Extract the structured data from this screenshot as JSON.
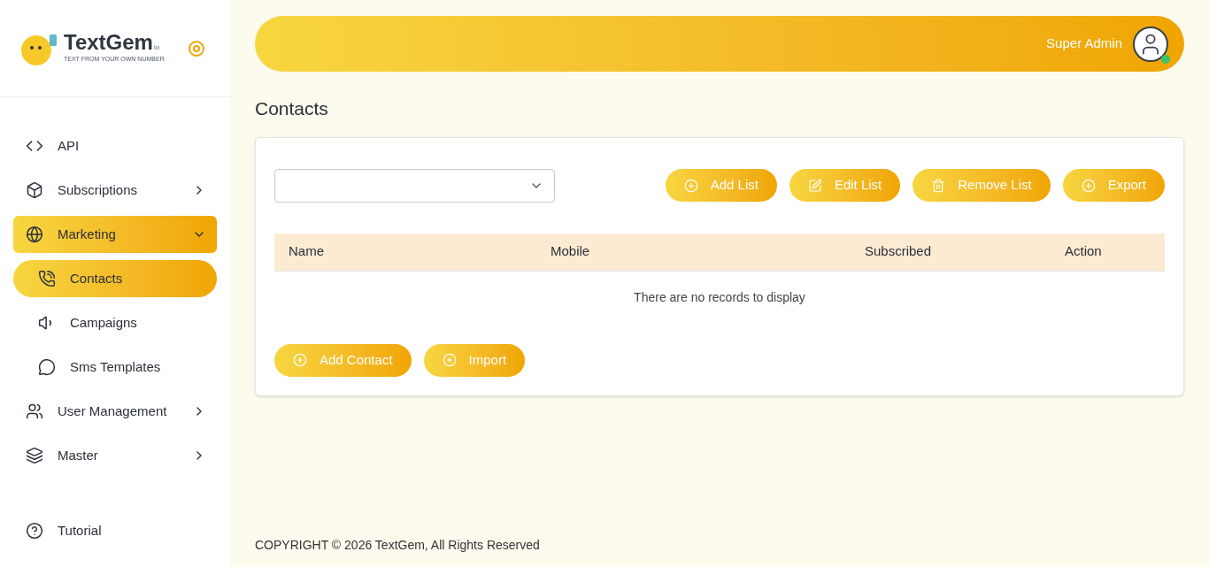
{
  "logo": {
    "name": "TextGem",
    "suffix": "io",
    "tagline": "TEXT FROM YOUR OWN NUMBER"
  },
  "sidebar": {
    "items": [
      {
        "label": "API",
        "selected": false
      },
      {
        "label": "Subscriptions",
        "selected": false,
        "expanded": false
      },
      {
        "label": "Marketing",
        "selected": true,
        "expanded": true,
        "children": [
          {
            "label": "Contacts",
            "selected": true
          },
          {
            "label": "Campaigns",
            "selected": false
          },
          {
            "label": "Sms Templates",
            "selected": false
          }
        ]
      },
      {
        "label": "User Management",
        "selected": false,
        "expanded": false
      },
      {
        "label": "Master",
        "selected": false,
        "expanded": false
      }
    ],
    "footer_item": {
      "label": "Tutorial"
    }
  },
  "header": {
    "user": "Super Admin"
  },
  "page_title": "Contacts",
  "toolbar": {
    "buttons": [
      {
        "label": "Add List"
      },
      {
        "label": "Edit List"
      },
      {
        "label": "Remove List"
      },
      {
        "label": "Export"
      }
    ]
  },
  "table": {
    "columns": [
      "Name",
      "Mobile",
      "Subscribed",
      "Action"
    ],
    "empty_message": "There are no records to display"
  },
  "bottom_buttons": [
    {
      "label": "Add Contact"
    },
    {
      "label": "Import"
    }
  ],
  "footer": "COPYRIGHT © 2026 TextGem, All Rights Reserved"
}
